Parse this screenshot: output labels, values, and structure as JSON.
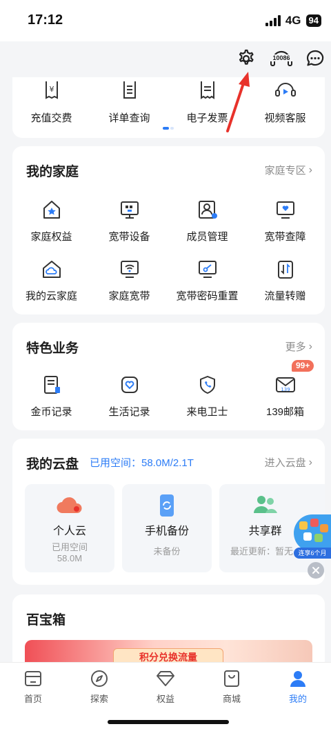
{
  "status": {
    "time": "17:12",
    "network": "4G",
    "battery": "94"
  },
  "header": {
    "settings_icon": "gear-icon",
    "service_hotline": "10086",
    "message_icon": "chat-bubble-icon",
    "accent_color": "#e8322b"
  },
  "quick_services": {
    "items": [
      {
        "label": "充值交费",
        "icon": "yuan-receipt-icon"
      },
      {
        "label": "详单查询",
        "icon": "list-document-icon"
      },
      {
        "label": "电子发票",
        "icon": "invoice-icon"
      },
      {
        "label": "视频客服",
        "icon": "video-headset-icon"
      }
    ]
  },
  "family": {
    "title": "我的家庭",
    "more": "家庭专区",
    "items": [
      {
        "label": "家庭权益",
        "icon": "house-star-icon"
      },
      {
        "label": "宽带设备",
        "icon": "router-screen-icon"
      },
      {
        "label": "成员管理",
        "icon": "member-card-icon"
      },
      {
        "label": "宽带查障",
        "icon": "heart-monitor-icon"
      },
      {
        "label": "我的云家庭",
        "icon": "cloud-house-icon"
      },
      {
        "label": "家庭宽带",
        "icon": "wifi-monitor-icon"
      },
      {
        "label": "宽带密码重置",
        "icon": "key-monitor-icon"
      },
      {
        "label": "流量转赠",
        "icon": "transfer-icon"
      }
    ]
  },
  "featured": {
    "title": "特色业务",
    "more": "更多",
    "items": [
      {
        "label": "金币记录",
        "icon": "coin-record-icon"
      },
      {
        "label": "生活记录",
        "icon": "life-record-icon"
      },
      {
        "label": "来电卫士",
        "icon": "phone-shield-icon"
      },
      {
        "label": "139邮箱",
        "icon": "mail-139-icon",
        "badge": "99+"
      }
    ]
  },
  "cloud": {
    "title": "我的云盘",
    "usage": "已用空间：58.0M/2.1T",
    "more": "进入云盘",
    "tiles": [
      {
        "title": "个人云",
        "sub1": "已用空间",
        "sub2": "58.0M",
        "icon": "personal-cloud-icon"
      },
      {
        "title": "手机备份",
        "sub1": "未备份",
        "sub2": "",
        "icon": "phone-backup-icon"
      },
      {
        "title": "共享群",
        "sub1": "最近更新：暂无",
        "sub2": "",
        "icon": "share-group-icon"
      }
    ],
    "promo_text": "连享6个月"
  },
  "toolbox": {
    "title": "百宝箱",
    "banner_text": "积分兑换流量"
  },
  "bottom_nav": [
    {
      "label": "首页",
      "icon": "home-icon"
    },
    {
      "label": "探索",
      "icon": "compass-icon"
    },
    {
      "label": "权益",
      "icon": "diamond-icon"
    },
    {
      "label": "商城",
      "icon": "shop-bag-icon"
    },
    {
      "label": "我的",
      "icon": "person-icon",
      "active": true
    }
  ]
}
